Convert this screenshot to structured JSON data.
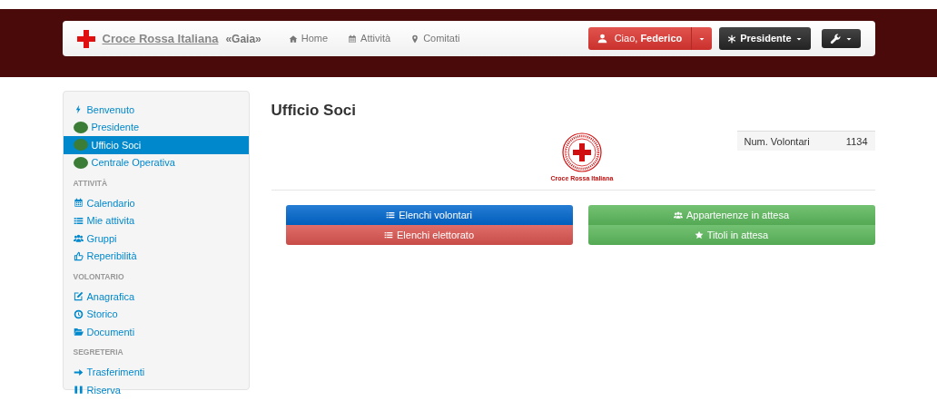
{
  "navbar": {
    "brand": "Croce Rossa Italiana",
    "tagline": "«Gaia»",
    "links": [
      {
        "kind": "home",
        "label": "Home"
      },
      {
        "kind": "calendar",
        "label": "Attività"
      },
      {
        "kind": "pin",
        "label": "Comitati"
      }
    ],
    "user_button": "Ciao, **Federico**",
    "role_button": "Presidente"
  },
  "sidebar": {
    "sections": [
      {
        "items": [
          {
            "kind": "bolt",
            "label": "Benvenuto",
            "selected": false
          },
          {
            "kind": "dot",
            "label": "Presidente",
            "selected": false
          },
          {
            "kind": "dot",
            "label": "Ufficio Soci",
            "selected": true
          },
          {
            "kind": "dot",
            "label": "Centrale Operativa",
            "selected": false
          }
        ]
      },
      {
        "heading": "ATTIVITÀ",
        "items": [
          {
            "kind": "calendar",
            "label": "Calendario",
            "selected": false
          },
          {
            "kind": "list",
            "label": "Mie attivita",
            "selected": false
          },
          {
            "kind": "group",
            "label": "Gruppi",
            "selected": false
          },
          {
            "kind": "thumb",
            "label": "Reperibilità",
            "selected": false
          }
        ]
      },
      {
        "heading": "VOLONTARIO",
        "items": [
          {
            "kind": "edit",
            "label": "Anagrafica",
            "selected": false
          },
          {
            "kind": "clock",
            "label": "Storico",
            "selected": false
          },
          {
            "kind": "folder",
            "label": "Documenti",
            "selected": false
          }
        ]
      },
      {
        "heading": "SEGRETERIA",
        "items": [
          {
            "kind": "arrow",
            "label": "Trasferimenti",
            "selected": false
          },
          {
            "kind": "pause",
            "label": "Riserva",
            "selected": false
          }
        ]
      }
    ]
  },
  "main": {
    "title": "Ufficio Soci",
    "logo_caption": "Croce Rossa Italiana",
    "stats": [
      {
        "label": "Num. Volontari",
        "value": "1134"
      }
    ],
    "button_columns": [
      [
        {
          "kind": "list",
          "label": "Elenchi volontari",
          "color": "#0066cc"
        },
        {
          "kind": "list",
          "label": "Elenchi elettorato",
          "color": "#d9534f"
        }
      ],
      [
        {
          "kind": "group",
          "label": "Appartenenze in attesa",
          "color": "#5bb75b"
        },
        {
          "kind": "star",
          "label": "Titoli in attesa",
          "color": "#5bb75b"
        }
      ]
    ]
  }
}
